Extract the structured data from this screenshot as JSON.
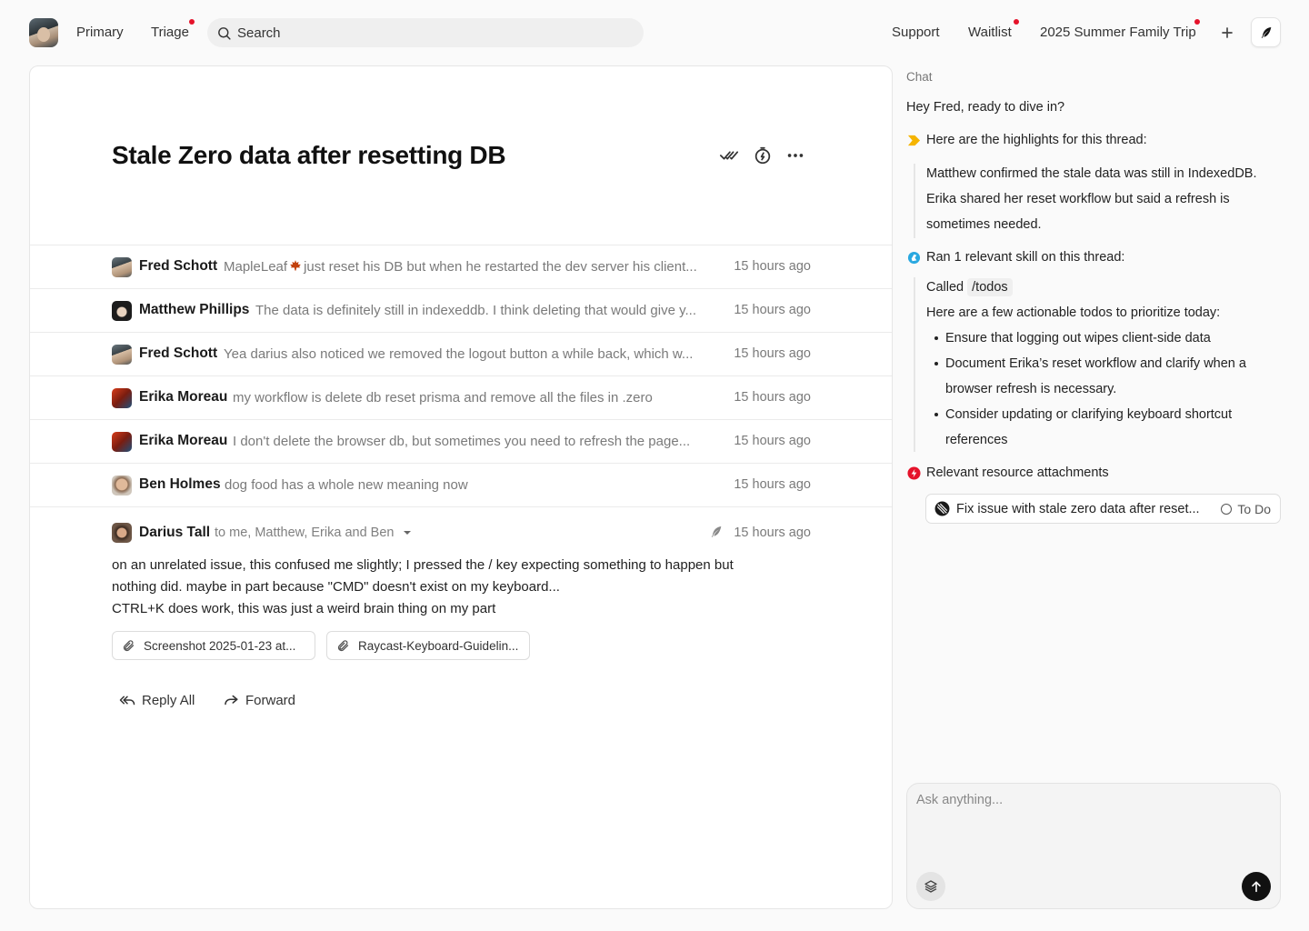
{
  "nav": {
    "primary_label": "Primary",
    "triage_label": "Triage",
    "search_placeholder": "Search",
    "support_label": "Support",
    "waitlist_label": "Waitlist",
    "trip_label": "2025 Summer Family Trip",
    "plus_icon": "plus-icon",
    "compose_icon": "feather-icon",
    "unread_color": "#e5122a"
  },
  "thread": {
    "title": "Stale Zero data after resetting DB",
    "actions": [
      "check-double-icon",
      "timer-icon",
      "more-icon"
    ],
    "messages": [
      {
        "sender": "Fred Schott",
        "snippet_prefix": "MapleLeaf",
        "snippet": "just reset his DB but when he restarted the dev server his client...",
        "time": "15 hours ago"
      },
      {
        "sender": "Matthew Phillips",
        "snippet": "The data is definitely still in indexeddb. I think deleting that would give y...",
        "time": "15 hours ago"
      },
      {
        "sender": "Fred Schott",
        "snippet": "Yea darius also noticed we removed the logout button a while back, which w...",
        "time": "15 hours ago"
      },
      {
        "sender": "Erika Moreau",
        "snippet": "my workflow is delete db reset prisma and remove all the files in .zero",
        "time": "15 hours ago"
      },
      {
        "sender": "Erika Moreau",
        "snippet": "I don't delete the browser db, but sometimes you need to refresh the page...",
        "time": "15 hours ago"
      },
      {
        "sender": "Ben Holmes",
        "snippet": "dog food has a whole new meaning now",
        "time": "15 hours ago"
      }
    ],
    "expanded": {
      "sender": "Darius Tall",
      "recipients": "to me, Matthew, Erika and Ben",
      "time": "15 hours ago",
      "body_line1": "on an unrelated issue, this confused me slightly; I pressed the / key expecting something to happen but",
      "body_line2": "nothing did. maybe in part because \"CMD\" doesn't exist on my keyboard...",
      "body_line3": "CTRL+K does work, this was just a weird brain thing on my part",
      "attachments": [
        "Screenshot 2025-01-23 at...",
        "Raycast-Keyboard-Guidelin..."
      ],
      "reply_all_label": "Reply All",
      "forward_label": "Forward"
    }
  },
  "chat": {
    "label": "Chat",
    "greeting": "Hey Fred, ready to dive in?",
    "highlights_heading": "Here are the highlights for this thread:",
    "highlights_1": "Matthew confirmed the stale data was still in IndexedDB.",
    "highlights_2": "Erika shared her reset workflow but said a refresh is",
    "highlights_3": "sometimes needed.",
    "skill_heading": "Ran 1 relevant skill on this thread:",
    "called_label": "Called",
    "command": "/todos",
    "todos_intro": "Here are a few actionable todos to prioritize today:",
    "todos": [
      "Ensure that logging out wipes client-side data",
      "Document Erika’s reset workflow and clarify when a browser refresh is necessary.",
      "Consider updating or clarifying keyboard shortcut references"
    ],
    "resources_heading": "Relevant resource attachments",
    "resource": {
      "title": "Fix issue with stale zero data after reset...",
      "status": "To Do"
    },
    "input_placeholder": "Ask anything...",
    "accent_highlight": "#f5b400",
    "accent_skill": "#29a8e0",
    "accent_resource": "#e5122a"
  }
}
